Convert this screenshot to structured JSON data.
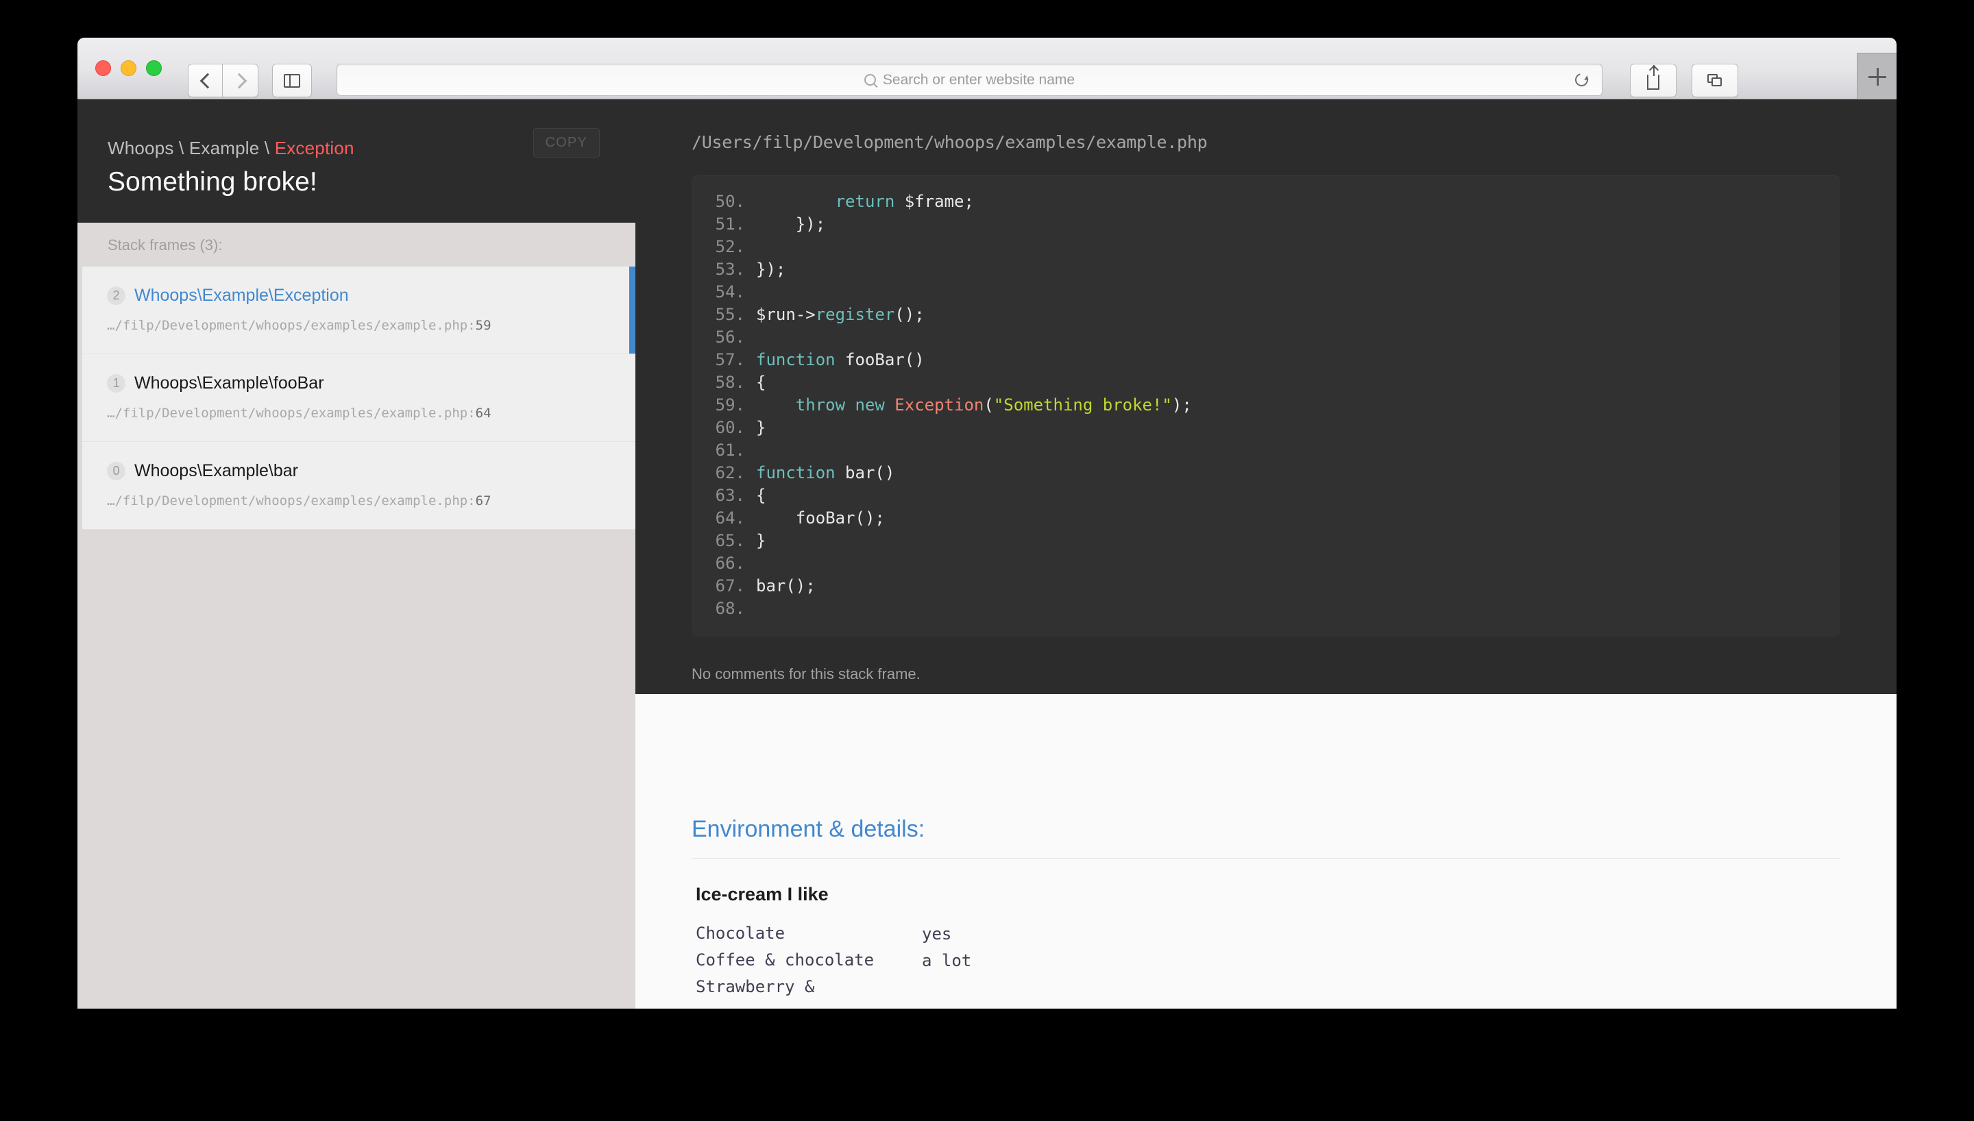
{
  "browser": {
    "url_placeholder": "Search or enter website name",
    "icons": {
      "back": "chevron-left-icon",
      "forward": "chevron-right-icon",
      "sidebar": "sidebar-toggle-icon",
      "search": "search-icon",
      "reload": "reload-icon",
      "share": "share-icon",
      "tabs": "tab-overview-icon",
      "new_tab": "plus-icon"
    }
  },
  "exception": {
    "namespace_prefix": "Whoops \\ Example \\ ",
    "class_name": "Exception",
    "message": "Something broke!",
    "copy_label": "COPY",
    "accent_error_color": "#ff5c5c"
  },
  "frames_panel": {
    "label": "Stack frames (3):",
    "accent_color": "#4288ce",
    "frames": [
      {
        "index": "2",
        "function": "Whoops\\Example\\Exception",
        "file": "…/filp/Development/whoops/examples/example.php:",
        "line": "59",
        "active": true
      },
      {
        "index": "1",
        "function": "Whoops\\Example\\fooBar",
        "file": "…/filp/Development/whoops/examples/example.php:",
        "line": "64",
        "active": false
      },
      {
        "index": "0",
        "function": "Whoops\\Example\\bar",
        "file": "…/filp/Development/whoops/examples/example.php:",
        "line": "67",
        "active": false
      }
    ]
  },
  "code_panel": {
    "filename": "/Users/filp/Development/whoops/examples/example.php",
    "no_comments_text": "No comments for this stack frame.",
    "lines": [
      {
        "number": "50.",
        "tokens": [
          {
            "t": "        ",
            "c": "plain"
          },
          {
            "t": "return",
            "c": "kw"
          },
          {
            "t": " $frame;",
            "c": "plain"
          }
        ]
      },
      {
        "number": "51.",
        "tokens": [
          {
            "t": "    });",
            "c": "plain"
          }
        ]
      },
      {
        "number": "52.",
        "tokens": [
          {
            "t": "",
            "c": "plain"
          }
        ]
      },
      {
        "number": "53.",
        "tokens": [
          {
            "t": "});",
            "c": "plain"
          }
        ]
      },
      {
        "number": "54.",
        "tokens": [
          {
            "t": "",
            "c": "plain"
          }
        ]
      },
      {
        "number": "55.",
        "tokens": [
          {
            "t": "$run->",
            "c": "plain"
          },
          {
            "t": "register",
            "c": "kw"
          },
          {
            "t": "();",
            "c": "plain"
          }
        ]
      },
      {
        "number": "56.",
        "tokens": [
          {
            "t": "",
            "c": "plain"
          }
        ]
      },
      {
        "number": "57.",
        "tokens": [
          {
            "t": "function",
            "c": "kw"
          },
          {
            "t": " fooBar()",
            "c": "plain"
          }
        ]
      },
      {
        "number": "58.",
        "tokens": [
          {
            "t": "{",
            "c": "plain"
          }
        ]
      },
      {
        "number": "59.",
        "tokens": [
          {
            "t": "    ",
            "c": "plain"
          },
          {
            "t": "throw new ",
            "c": "kw"
          },
          {
            "t": "Exception",
            "c": "cls"
          },
          {
            "t": "(",
            "c": "plain"
          },
          {
            "t": "\"Something broke!\"",
            "c": "str"
          },
          {
            "t": ");",
            "c": "plain"
          }
        ]
      },
      {
        "number": "60.",
        "tokens": [
          {
            "t": "}",
            "c": "plain"
          }
        ]
      },
      {
        "number": "61.",
        "tokens": [
          {
            "t": "",
            "c": "plain"
          }
        ]
      },
      {
        "number": "62.",
        "tokens": [
          {
            "t": "function",
            "c": "kw"
          },
          {
            "t": " bar()",
            "c": "plain"
          }
        ]
      },
      {
        "number": "63.",
        "tokens": [
          {
            "t": "{",
            "c": "plain"
          }
        ]
      },
      {
        "number": "64.",
        "tokens": [
          {
            "t": "    fooBar();",
            "c": "plain"
          }
        ]
      },
      {
        "number": "65.",
        "tokens": [
          {
            "t": "}",
            "c": "plain"
          }
        ]
      },
      {
        "number": "66.",
        "tokens": [
          {
            "t": "",
            "c": "plain"
          }
        ]
      },
      {
        "number": "67.",
        "tokens": [
          {
            "t": "bar();",
            "c": "plain"
          }
        ]
      },
      {
        "number": "68.",
        "tokens": [
          {
            "t": "",
            "c": "plain"
          }
        ]
      }
    ]
  },
  "environment": {
    "title": "Environment & details:",
    "groups": [
      {
        "title": "Ice-cream I like",
        "rows": [
          {
            "key": "Chocolate",
            "value": "yes"
          },
          {
            "key": "Coffee & chocolate",
            "value": "a lot"
          },
          {
            "key": "Strawberry &",
            "value": ""
          }
        ]
      }
    ]
  }
}
